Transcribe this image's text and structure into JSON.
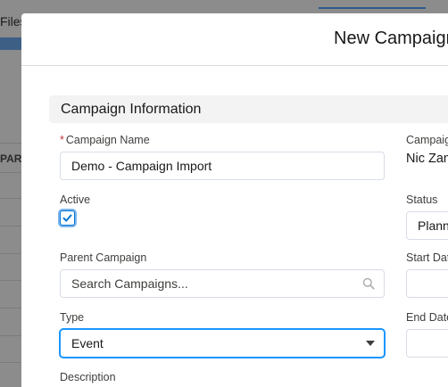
{
  "background": {
    "files_label": "Files",
    "column_header": "PARENT"
  },
  "modal": {
    "title": "New Campaign",
    "section_title": "Campaign Information",
    "fields": {
      "campaign_name": {
        "label": "Campaign Name",
        "required_mark": "*",
        "value": "Demo - Campaign Import"
      },
      "active": {
        "label": "Active",
        "checked": true
      },
      "parent_campaign": {
        "label": "Parent Campaign",
        "placeholder": "Search Campaigns..."
      },
      "type": {
        "label": "Type",
        "value": "Event"
      },
      "description": {
        "label": "Description"
      },
      "campaign_owner": {
        "label": "Campaign Owner",
        "value": "Nic Zamora"
      },
      "status": {
        "label": "Status",
        "value": "Planned"
      },
      "start_date": {
        "label": "Start Date",
        "value": ""
      },
      "end_date": {
        "label": "End Date",
        "value": ""
      }
    }
  },
  "colors": {
    "accent": "#0176d3",
    "focus_border": "#1b96ff",
    "required": "#c23934",
    "overlay": "#8c8c8c"
  }
}
